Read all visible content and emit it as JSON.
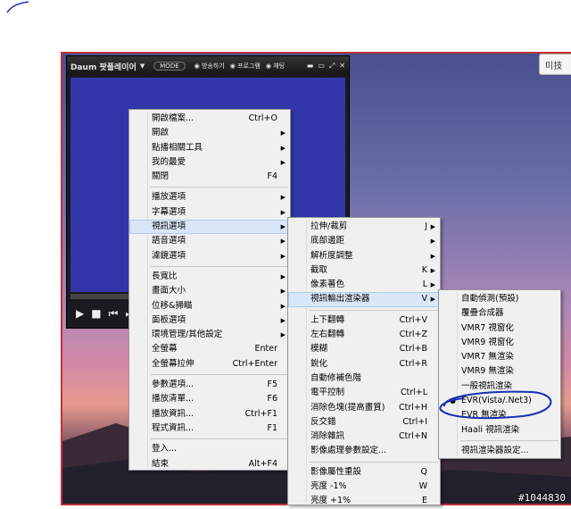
{
  "player": {
    "title": "Daum 팟플레이어",
    "mode_label": "MODE",
    "radio_options": [
      "방송하기",
      "프로그램",
      "채팅"
    ],
    "win_controls": [
      "▬",
      "▭",
      "⤢",
      "✕"
    ]
  },
  "corner_tab": "미技",
  "menu_main": [
    {
      "label": "開啟檔案...",
      "shortcut": "Ctrl+O"
    },
    {
      "label": "開啟",
      "arrow": true
    },
    {
      "label": "點播相關工具",
      "arrow": true
    },
    {
      "label": "我的最愛",
      "arrow": true
    },
    {
      "label": "關閉",
      "shortcut": "F4"
    },
    {
      "sep": true
    },
    {
      "label": "播放選項",
      "arrow": true
    },
    {
      "label": "字幕選項",
      "arrow": true
    },
    {
      "label": "視訊選項",
      "arrow": true,
      "highlight": true
    },
    {
      "label": "語音選項",
      "arrow": true
    },
    {
      "label": "濾鏡選項",
      "arrow": true
    },
    {
      "sep": true
    },
    {
      "label": "長寬比",
      "arrow": true
    },
    {
      "label": "畫面大小",
      "arrow": true
    },
    {
      "label": "位移&掃瞄",
      "arrow": true
    },
    {
      "label": "面板選項",
      "arrow": true
    },
    {
      "label": "環境管理/其他設定",
      "arrow": true
    },
    {
      "label": "全螢幕",
      "shortcut": "Enter"
    },
    {
      "label": "全螢幕拉伸",
      "shortcut": "Ctrl+Enter"
    },
    {
      "sep": true
    },
    {
      "label": "參數選項...",
      "shortcut": "F5"
    },
    {
      "label": "播放清單...",
      "shortcut": "F6"
    },
    {
      "label": "播放資訊...",
      "shortcut": "Ctrl+F1"
    },
    {
      "label": "程式資訊...",
      "shortcut": "F1"
    },
    {
      "sep": true
    },
    {
      "label": "登入..."
    },
    {
      "label": "結束",
      "shortcut": "Alt+F4"
    }
  ],
  "menu_video": [
    {
      "label": "拉伸/裁剪",
      "shortcut": "J",
      "arrow": true
    },
    {
      "label": "底部邊距",
      "arrow": true
    },
    {
      "label": "解析度調整",
      "arrow": true
    },
    {
      "label": "截取",
      "shortcut": "K",
      "arrow": true
    },
    {
      "label": "像素著色",
      "shortcut": "L",
      "arrow": true
    },
    {
      "label": "視訊輸出渲染器",
      "shortcut": "V",
      "arrow": true,
      "highlight": true
    },
    {
      "sep": true
    },
    {
      "label": "上下翻轉",
      "shortcut": "Ctrl+V"
    },
    {
      "label": "左右翻轉",
      "shortcut": "Ctrl+Z"
    },
    {
      "label": "模糊",
      "shortcut": "Ctrl+B"
    },
    {
      "label": "銳化",
      "shortcut": "Ctrl+R"
    },
    {
      "label": "自動修補色階"
    },
    {
      "label": "電平控制",
      "shortcut": "Ctrl+L"
    },
    {
      "label": "消除色塊(提高畫質)",
      "shortcut": "Ctrl+H"
    },
    {
      "label": "反交錯",
      "shortcut": "Ctrl+I"
    },
    {
      "label": "消除雜訊",
      "shortcut": "Ctrl+N"
    },
    {
      "label": "影像處理參數設定..."
    },
    {
      "sep": true
    },
    {
      "label": "影像屬性重設",
      "shortcut": "Q"
    },
    {
      "label": "亮度 -1%",
      "shortcut": "W"
    },
    {
      "label": "亮度 +1%",
      "shortcut": "E"
    }
  ],
  "menu_renderer": [
    {
      "label": "自動偵測(預設)"
    },
    {
      "label": "覆疊合成器"
    },
    {
      "label": "VMR7 視窗化"
    },
    {
      "label": "VMR9 視窗化"
    },
    {
      "label": "VMR7 無渲染"
    },
    {
      "label": "VMR9 無渲染"
    },
    {
      "label": "一般視訊渲染"
    },
    {
      "label": "EVR(Vista/.Net3)",
      "selected": true
    },
    {
      "label": "EVR 無渲染"
    },
    {
      "label": "Haali 視訊渲染"
    },
    {
      "sep": true
    },
    {
      "label": "視訊渲染器設定..."
    }
  ],
  "watermark": "#1044830",
  "colors": {
    "frame_border": "#c0323a",
    "annotation_ink": "#1a2fb0",
    "menu_highlight": "#d9e6f7"
  }
}
